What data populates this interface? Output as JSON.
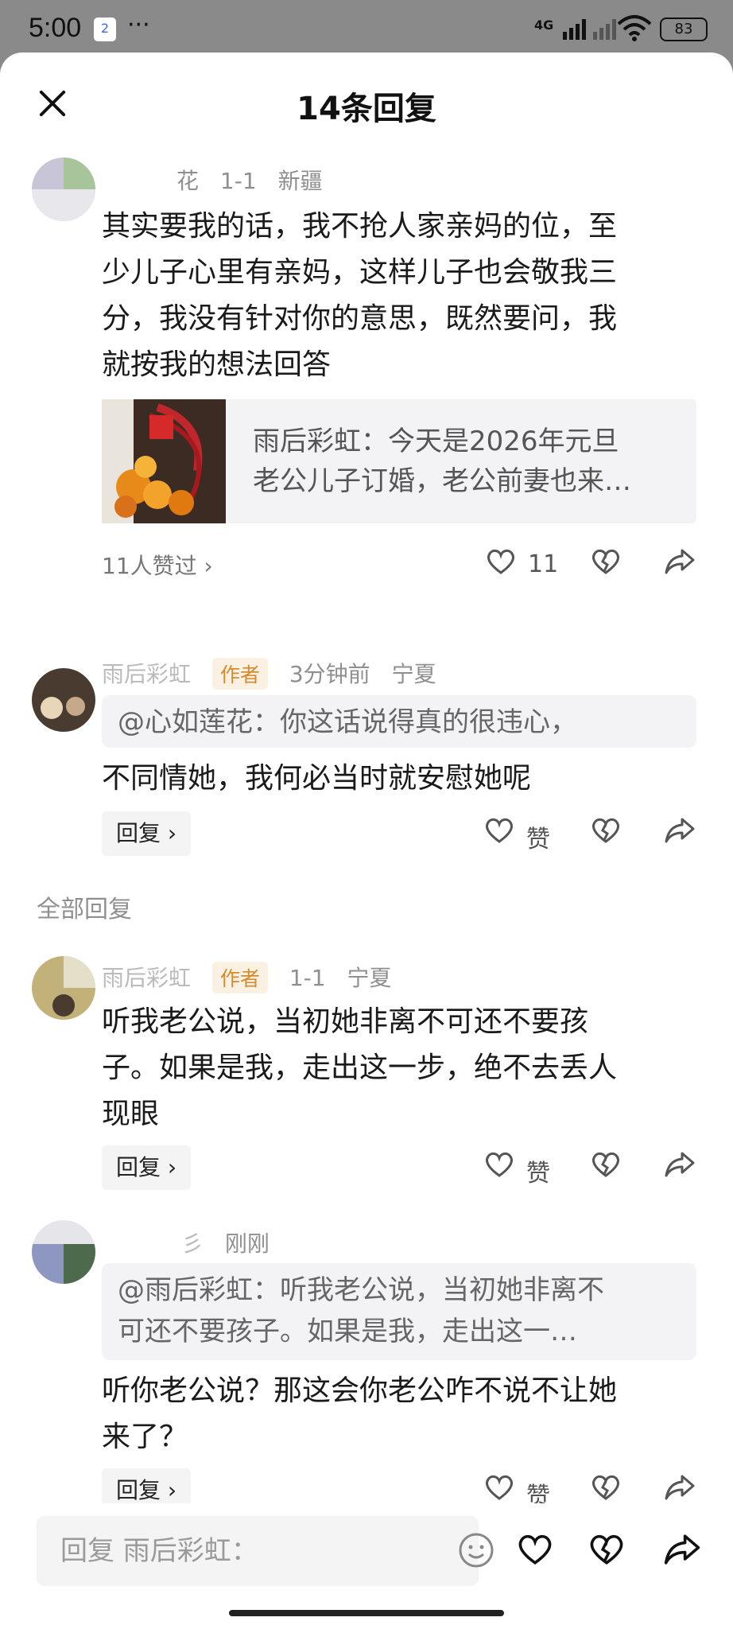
{
  "status_bar": {
    "time": "5:00",
    "app_badge": "2",
    "more_glyph": "···",
    "network": "4G",
    "battery": "83"
  },
  "header": {
    "title": "14条回复"
  },
  "comments": [
    {
      "username_fragment": "花",
      "date": "1-1",
      "location": "新疆",
      "text": "其实要我的话，我不抢人家亲妈的位，至少儿子心里有亲妈，这样儿子也会敬我三分，我没有针对你的意思，既然要问，我就按我的想法回答",
      "text_lines": [
        "其实要我的话，我不抢人家亲妈的位，至",
        "少儿子心里有亲妈，这样儿子也会敬我三",
        "分，我没有针对你的意思，既然要问，我",
        "就按我的想法回答"
      ],
      "media_card": {
        "line1": "雨后彩虹：今天是2026年元旦",
        "line2": "老公儿子订婚，老公前妻也来…"
      },
      "likes_text": "11人赞过",
      "like_count": "11"
    },
    {
      "username": "雨后彩虹",
      "author_tag": "作者",
      "time": "3分钟前",
      "location": "宁夏",
      "quote": "@心如莲花：你这话说得真的很违心，",
      "text": "不同情她，我何必当时就安慰她呢",
      "reply_label": "回复",
      "like_label": "赞"
    },
    {
      "username": "雨后彩虹",
      "author_tag": "作者",
      "date": "1-1",
      "location": "宁夏",
      "text_lines": [
        "听我老公说，当初她非离不可还不要孩",
        "子。如果是我，走出这一步，绝不去丢人",
        "现眼"
      ],
      "reply_label": "回复",
      "like_label": "赞"
    },
    {
      "username_fragment": "彡",
      "time": "刚刚",
      "quote_lines": [
        "@雨后彩虹：听我老公说，当初她非离不",
        "可还不要孩子。如果是我，走出这一…"
      ],
      "text_lines": [
        "听你老公说？那这会你老公咋不说不让她",
        "来了？"
      ],
      "reply_label": "回复",
      "like_label": "赞"
    }
  ],
  "section_label": "全部回复",
  "bottom_bar": {
    "placeholder": "回复 雨后彩虹："
  },
  "icons": [
    "close-icon",
    "heart-icon",
    "broken-heart-icon",
    "share-icon",
    "emoji-icon",
    "chevron-right-icon"
  ],
  "colors": {
    "author_tag_bg": "#fbf1e3",
    "author_tag_fg": "#d58a2d",
    "meta": "#8f8f8f"
  }
}
